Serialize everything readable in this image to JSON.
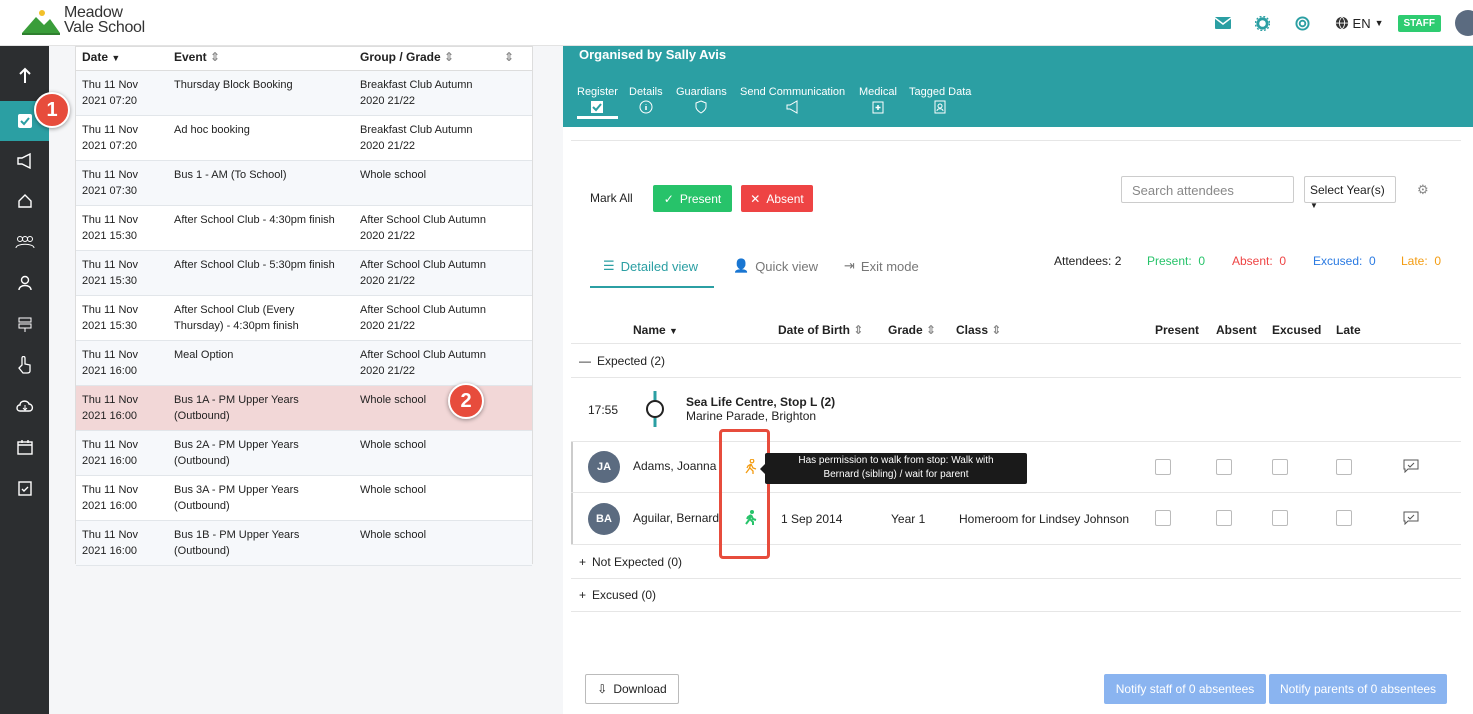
{
  "app": {
    "school_name_line1": "Meadow",
    "school_name_line2": "Vale School",
    "language": "EN",
    "staff_badge": "STAFF"
  },
  "markers": {
    "m1": "1",
    "m2": "2"
  },
  "sidebar": {
    "items": [
      "upload-icon",
      "register-icon",
      "megaphone-icon",
      "home-icon",
      "group-icon",
      "person-icon",
      "signpost-icon",
      "hand-pointer-icon",
      "cloud-icon",
      "calendar-icon",
      "clipboard-icon"
    ]
  },
  "events_table": {
    "headers": {
      "date": "Date",
      "event": "Event",
      "group": "Group / Grade"
    },
    "rows": [
      {
        "date1": "Thu 11 Nov",
        "date2": "2021 07:20",
        "event1": "Thursday Block Booking",
        "event2": "",
        "group1": "Breakfast Club Autumn",
        "group2": "2020 21/22"
      },
      {
        "date1": "Thu 11 Nov",
        "date2": "2021 07:20",
        "event1": "Ad hoc booking",
        "event2": "",
        "group1": "Breakfast Club Autumn",
        "group2": "2020 21/22"
      },
      {
        "date1": "Thu 11 Nov",
        "date2": "2021 07:30",
        "event1": "Bus 1 - AM (To School)",
        "event2": "",
        "group1": "Whole school",
        "group2": ""
      },
      {
        "date1": "Thu 11 Nov",
        "date2": "2021 15:30",
        "event1": "After School Club - 4:30pm finish",
        "event2": "",
        "group1": "After School Club Autumn",
        "group2": "2020 21/22"
      },
      {
        "date1": "Thu 11 Nov",
        "date2": "2021 15:30",
        "event1": "After School Club - 5:30pm finish",
        "event2": "",
        "group1": "After School Club Autumn",
        "group2": "2020 21/22"
      },
      {
        "date1": "Thu 11 Nov",
        "date2": "2021 15:30",
        "event1": "After School Club (Every",
        "event2": "Thursday) - 4:30pm finish",
        "group1": "After School Club Autumn",
        "group2": "2020 21/22"
      },
      {
        "date1": "Thu 11 Nov",
        "date2": "2021 16:00",
        "event1": "Meal Option",
        "event2": "",
        "group1": "After School Club Autumn",
        "group2": "2020 21/22"
      },
      {
        "date1": "Thu 11 Nov",
        "date2": "2021 16:00",
        "event1": "Bus 1A - PM Upper Years",
        "event2": "(Outbound)",
        "group1": "Whole school",
        "group2": ""
      },
      {
        "date1": "Thu 11 Nov",
        "date2": "2021 16:00",
        "event1": "Bus 2A - PM Upper Years",
        "event2": "(Outbound)",
        "group1": "Whole school",
        "group2": ""
      },
      {
        "date1": "Thu 11 Nov",
        "date2": "2021 16:00",
        "event1": "Bus 3A - PM Upper Years",
        "event2": "(Outbound)",
        "group1": "Whole school",
        "group2": ""
      },
      {
        "date1": "Thu 11 Nov",
        "date2": "2021 16:00",
        "event1": "Bus 1B - PM Upper Years",
        "event2": "(Outbound)",
        "group1": "Whole school",
        "group2": ""
      }
    ]
  },
  "detail": {
    "organiser": "Organised by Sally Avis",
    "tabs": [
      "Register",
      "Details",
      "Guardians",
      "Send Communication",
      "Medical",
      "Tagged Data"
    ],
    "mark_all": "Mark All",
    "present_btn": "Present",
    "absent_btn": "Absent",
    "search_placeholder": "Search attendees",
    "select_year": "Select Year(s)",
    "views": {
      "detailed": "Detailed view",
      "quick": "Quick view",
      "exit": "Exit mode"
    },
    "stats": {
      "attendees_label": "Attendees:",
      "attendees": "2",
      "present_label": "Present:",
      "present": "0",
      "absent_label": "Absent:",
      "absent": "0",
      "excused_label": "Excused:",
      "excused": "0",
      "late_label": "Late:",
      "late": "0"
    },
    "columns": {
      "name": "Name",
      "dob": "Date of Birth",
      "grade": "Grade",
      "class": "Class",
      "present": "Present",
      "absent": "Absent",
      "excused": "Excused",
      "late": "Late"
    },
    "expected_label": "Expected (2)",
    "stop": {
      "time": "17:55",
      "name": "Sea Life Centre, Stop L (2)",
      "address": "Marine Parade, Brighton"
    },
    "students": [
      {
        "initials": "JA",
        "name": "Adams, Joanna",
        "dob": "",
        "grade": "",
        "class": ""
      },
      {
        "initials": "BA",
        "name": "Aguilar, Bernard",
        "dob": "1 Sep 2014",
        "grade": "Year 1",
        "class": "Homeroom for Lindsey Johnson"
      }
    ],
    "tooltip_line1": "Has permission to walk from stop: Walk with",
    "tooltip_line2": "Bernard (sibling) / wait for parent",
    "not_expected_label": "Not Expected (0)",
    "excused_label": "Excused (0)",
    "download_btn": "Download",
    "notify_staff": "Notify staff of 0 absentees",
    "notify_parents": "Notify parents of 0 absentees"
  },
  "colors": {
    "teal": "#2b9fa3",
    "present_green": "#27c36a",
    "absent_red": "#ee4444",
    "excused_blue": "#2a7ae2",
    "late_orange": "#f39c12",
    "marker_red": "#e74c3c"
  }
}
